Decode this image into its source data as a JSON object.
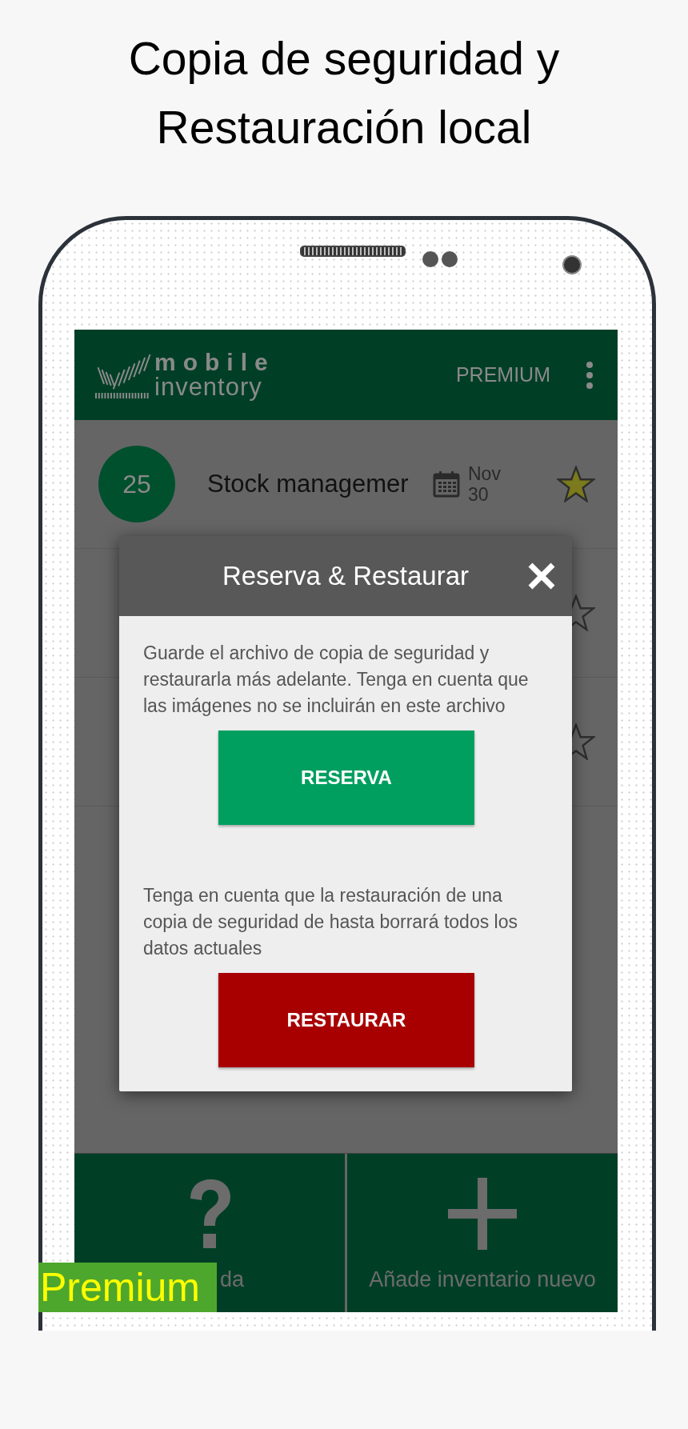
{
  "headline": [
    "Copia de seguridad y",
    "Restauración local"
  ],
  "app_bar": {
    "logo": {
      "line1": "mobile",
      "line2": "inventory"
    },
    "action": "PREMIUM"
  },
  "rows": [
    {
      "count": "25",
      "title": "Stock managemer",
      "month": "Nov",
      "day": "30",
      "favorite": true
    },
    {
      "favorite": false
    },
    {
      "favorite": false
    }
  ],
  "dialog": {
    "title": "Reserva & Restaurar",
    "backup_text": "Guarde el archivo de copia de seguridad y restaurarla más adelante. Tenga en cuenta que las imágenes no se incluirán en este archivo",
    "backup_button": "RESERVA",
    "restore_text": "Tenga en cuenta que la restauración de una copia de seguridad de hasta borrará todos los datos actuales",
    "restore_button": "RESTAURAR"
  },
  "bottom_nav": [
    {
      "kind": "help",
      "label": "da"
    },
    {
      "kind": "add",
      "label": "Añade inventario nuevo"
    }
  ],
  "badge": "Premium"
}
